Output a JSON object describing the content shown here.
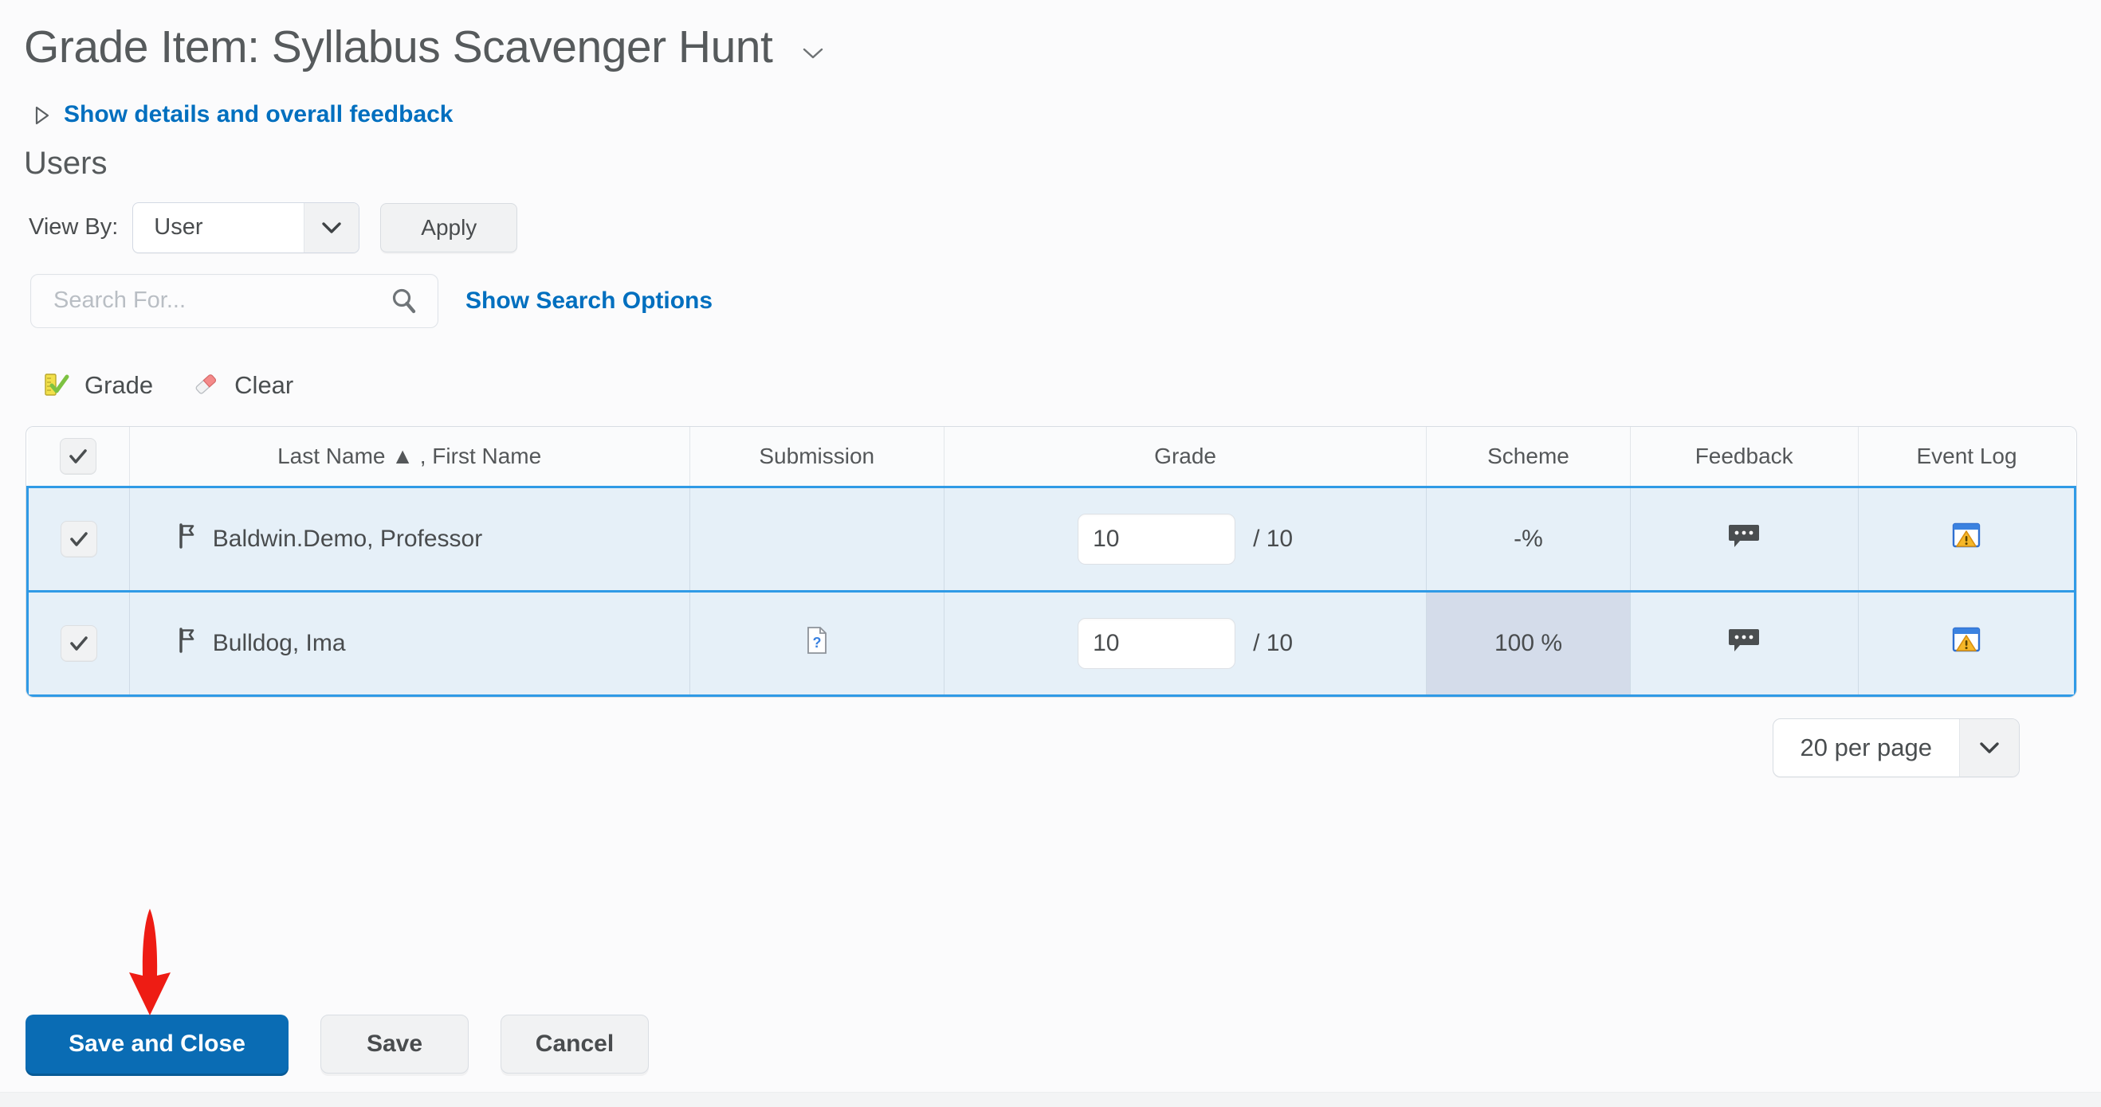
{
  "header": {
    "title": "Grade Item: Syllabus Scavenger Hunt",
    "title_chevron_icon": "chevron-down-icon",
    "details_link": "Show details and overall feedback",
    "details_triangle_icon": "triangle-right-icon"
  },
  "users_section": {
    "heading": "Users",
    "view_by_label": "View By:",
    "view_by_value": "User",
    "view_by_options": [
      "User"
    ],
    "apply_label": "Apply",
    "search_placeholder": "Search For...",
    "search_value": "",
    "search_icon": "magnifier-icon",
    "show_search_options": "Show Search Options"
  },
  "toolbar": {
    "grade_label": "Grade",
    "grade_icon": "ruler-check-icon",
    "clear_label": "Clear",
    "clear_icon": "eraser-icon"
  },
  "table": {
    "columns": [
      "Last Name ▲ , First Name",
      "Submission",
      "Grade",
      "Scheme",
      "Feedback",
      "Event Log"
    ],
    "sort_column": "Last Name",
    "sort_direction": "ascending",
    "select_all_checked": true,
    "rows": [
      {
        "checked": true,
        "flag_icon": "flag-icon",
        "name": "Baldwin.Demo, Professor",
        "submission_icon": "",
        "grade_value": "10",
        "grade_out_of": "/ 10",
        "scheme": "-%",
        "scheme_highlighted": false,
        "feedback_icon": "comment-icon",
        "event_log_icon": "event-log-warning-icon"
      },
      {
        "checked": true,
        "flag_icon": "flag-icon",
        "name": "Bulldog, Ima",
        "submission_icon": "document-question-icon",
        "grade_value": "10",
        "grade_out_of": "/ 10",
        "scheme": "100 %",
        "scheme_highlighted": true,
        "feedback_icon": "comment-icon",
        "event_log_icon": "event-log-warning-icon"
      }
    ]
  },
  "pagination": {
    "per_page_value": "20 per page",
    "per_page_options": [
      "20 per page"
    ]
  },
  "footer": {
    "save_and_close_label": "Save and Close",
    "save_label": "Save",
    "cancel_label": "Cancel"
  },
  "annotation": {
    "arrow_icon": "red-down-arrow-annotation",
    "arrow_color": "#EE1C14",
    "points_at": "Save and Close"
  },
  "colors": {
    "link": "#006FBF",
    "primary_button": "#0A6CB4",
    "selected_row_bg": "#E6F0F8",
    "selected_row_border": "#2F9AE6",
    "scheme_highlight": "#D4DCEA",
    "text": "#494C4E"
  }
}
